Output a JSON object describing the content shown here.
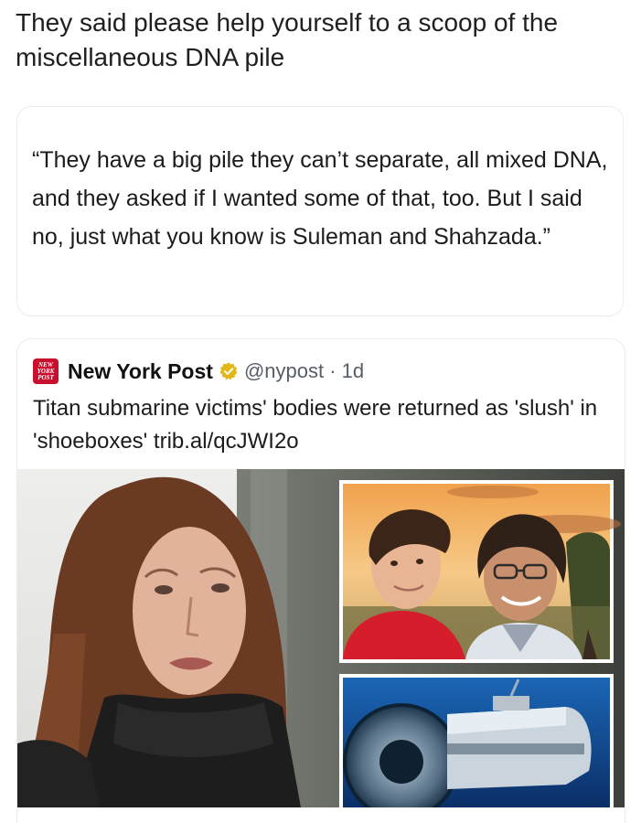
{
  "caption": "They said please help yourself to a scoop of the miscellaneous DNA pile",
  "quote": {
    "text": "“They have a big pile they can’t separate, all mixed DNA, and they asked if I wanted some of that, too. But I said no, just what you know is Suleman and Shahzada.”"
  },
  "tweet": {
    "avatar_lines": [
      "NEW",
      "YORK",
      "POST"
    ],
    "author": "New York Post",
    "handle_time": "@nypost · 1d",
    "text": "Titan submarine victims' bodies were returned as 'slush' in 'shoeboxes' trib.al/qcJWI2o",
    "verified_color": "#e2b719",
    "brand_color": "#c8102e"
  }
}
